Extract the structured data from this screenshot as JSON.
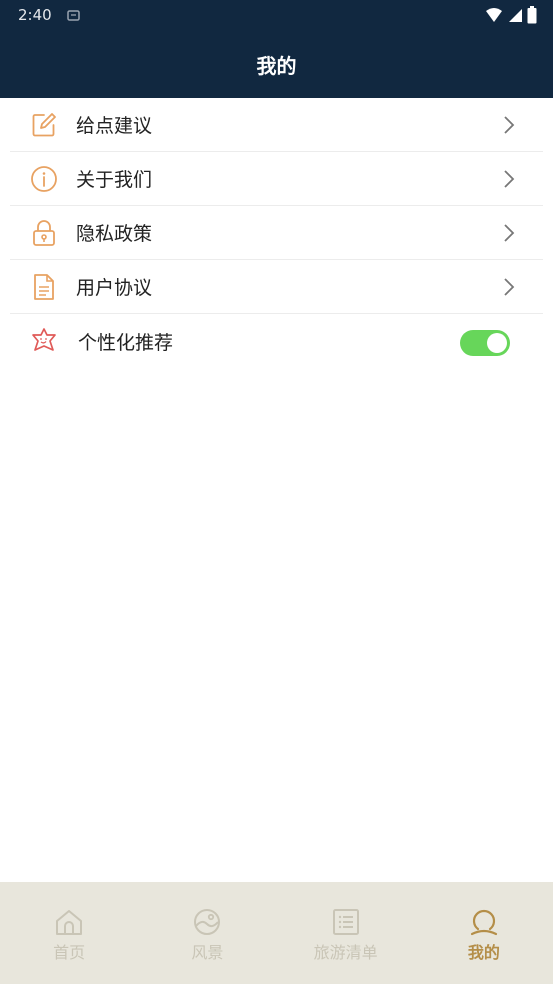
{
  "status_bar": {
    "time": "2:40"
  },
  "header": {
    "title": "我的"
  },
  "menu": {
    "items": [
      {
        "label": "给点建议",
        "icon": "edit-icon"
      },
      {
        "label": "关于我们",
        "icon": "info-icon"
      },
      {
        "label": "隐私政策",
        "icon": "lock-icon"
      },
      {
        "label": "用户协议",
        "icon": "document-icon"
      },
      {
        "label": "个性化推荐",
        "icon": "star-face-icon",
        "toggle_on": true
      }
    ]
  },
  "tabbar": {
    "tabs": [
      {
        "label": "首页",
        "icon": "home-icon",
        "active": false
      },
      {
        "label": "风景",
        "icon": "scenery-icon",
        "active": false
      },
      {
        "label": "旅游清单",
        "icon": "list-icon",
        "active": false
      },
      {
        "label": "我的",
        "icon": "profile-icon",
        "active": true
      }
    ]
  },
  "colors": {
    "header_bg": "#112840",
    "accent_orange": "#e8a262",
    "toggle_green": "#67d65a",
    "tab_active": "#b48e48",
    "tab_inactive": "#c9c5b6",
    "tabbar_bg": "#e8e6dc"
  }
}
